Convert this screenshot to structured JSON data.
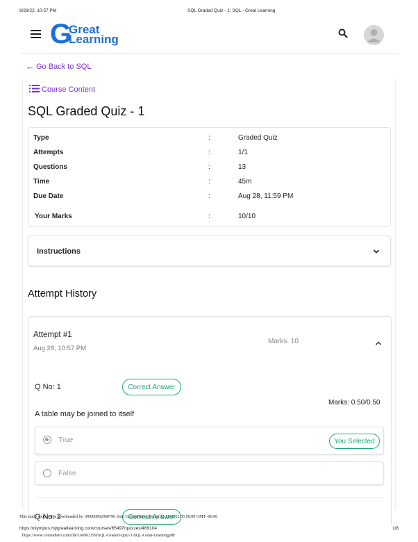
{
  "print_header": {
    "datetime": "8/28/22, 10:57 PM",
    "page_title": "SQL Graded Quiz - 1: SQL - Great Learning"
  },
  "header": {
    "logo_line1": "Great",
    "logo_line2": "Learning",
    "logo_g": "G",
    "brand_color": "#1d6fd6",
    "icons": [
      "hamburger-icon",
      "search-icon",
      "avatar"
    ]
  },
  "nav": {
    "back_link": "Go Back to SQL",
    "course_content": "Course Content",
    "link_color": "#7b2fd4"
  },
  "quiz": {
    "title": "SQL Graded Quiz - 1",
    "details": [
      {
        "label": "Type",
        "sep": ":",
        "value": "Graded Quiz"
      },
      {
        "label": "Attempts",
        "sep": ":",
        "value": "1/1"
      },
      {
        "label": "Questions",
        "sep": ":",
        "value": "13"
      },
      {
        "label": "Time",
        "sep": ":",
        "value": "45m"
      },
      {
        "label": "Due Date",
        "sep": ":",
        "value": "Aug 28, 11:59 PM"
      }
    ],
    "marks": {
      "label": "Your Marks",
      "sep": ":",
      "value": "10/10"
    }
  },
  "instructions": {
    "label": "Instructions"
  },
  "attempt_history": {
    "title": "Attempt History",
    "attempt_label": "Attempt #1",
    "attempt_date": "Aug 28, 10:57 PM",
    "attempt_marks": "Marks: 10",
    "question": {
      "number": "Q No: 1",
      "status": "Correct Answer",
      "marks": "Marks: 0.50/0.50",
      "text": "A table may be joined to itself",
      "options": [
        {
          "label": "True",
          "selected": true,
          "badge": "You Selected"
        },
        {
          "label": "False",
          "selected": false,
          "badge": ""
        }
      ]
    },
    "next_question": {
      "number": "Q No: 2",
      "status": "Correct Answer"
    }
  },
  "accent_green": "#1ea672",
  "watermark": "This study source was downloaded by 100000852960796 from CourseHero.com on 12-25-2022 05:50:09 GMT -06:00",
  "print_footer": {
    "url": "https://olympus.mygreatlearning.com/courses/65497/quizzes/469104",
    "page": "1/8",
    "coursehero_url": "https://www.coursehero.com/file/166902199/SQL-Graded-Quiz-1-SQL-Great-Learningpdf/"
  }
}
